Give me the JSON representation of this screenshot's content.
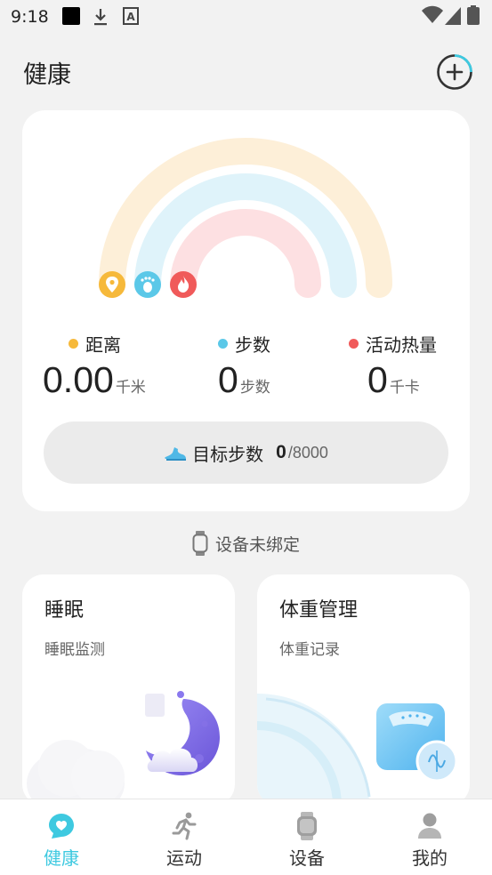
{
  "status_bar": {
    "time": "9:18",
    "sb_letter": "A"
  },
  "header": {
    "title": "健康"
  },
  "summary": {
    "distance": {
      "label": "距离",
      "value": "0.00",
      "unit": "千米"
    },
    "steps": {
      "label": "步数",
      "value": "0",
      "unit": "步数"
    },
    "calories": {
      "label": "活动热量",
      "value": "0",
      "unit": "千卡"
    },
    "goal": {
      "label": "目标步数",
      "current": "0",
      "total": "/8000"
    }
  },
  "colors": {
    "distance": "#f6b93b",
    "steps": "#5bc8e8",
    "calories": "#f05a5a",
    "accent": "#3ec9e0"
  },
  "device_status": {
    "text": "设备未绑定"
  },
  "cards": {
    "sleep": {
      "title": "睡眠",
      "subtitle": "睡眠监测"
    },
    "weight": {
      "title": "体重管理",
      "subtitle": "体重记录"
    }
  },
  "tabs": [
    {
      "label": "健康",
      "icon": "heart-chat-icon",
      "active": true
    },
    {
      "label": "运动",
      "icon": "running-icon",
      "active": false
    },
    {
      "label": "设备",
      "icon": "watch-icon",
      "active": false
    },
    {
      "label": "我的",
      "icon": "person-icon",
      "active": false
    }
  ]
}
